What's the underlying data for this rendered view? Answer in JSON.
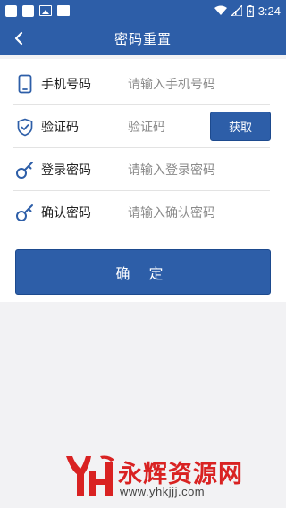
{
  "status_bar": {
    "time": "3:24"
  },
  "header": {
    "title": "密码重置"
  },
  "form": {
    "rows": [
      {
        "label": "手机号码",
        "placeholder": "请输入手机号码",
        "icon": "phone-icon"
      },
      {
        "label": "验证码",
        "placeholder": "验证码",
        "icon": "shield-check-icon",
        "action_label": "获取"
      },
      {
        "label": "登录密码",
        "placeholder": "请输入登录密码",
        "icon": "key-icon"
      },
      {
        "label": "确认密码",
        "placeholder": "请输入确认密码",
        "icon": "key-icon"
      }
    ],
    "submit_label": "确 定"
  },
  "watermark": {
    "brand": "永辉资源网",
    "url": "www.yhkjjj.com"
  },
  "colors": {
    "primary": "#2d5ea8",
    "background": "#f2f2f4",
    "watermark_red": "#d92222"
  }
}
